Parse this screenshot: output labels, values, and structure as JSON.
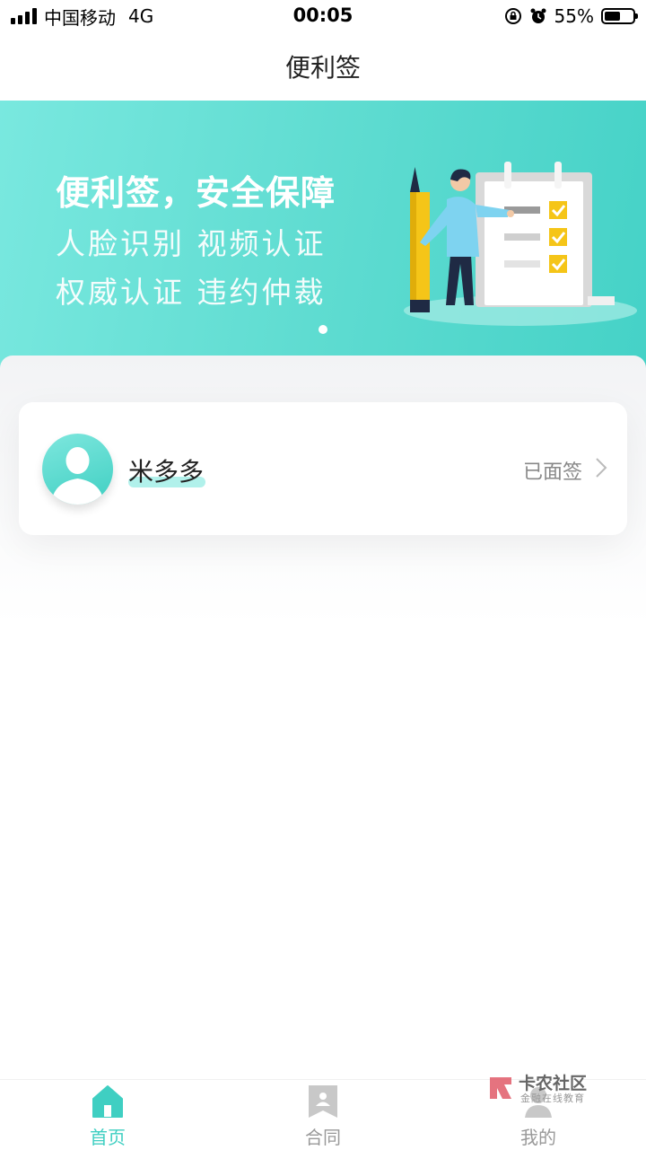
{
  "status_bar": {
    "carrier": "中国移动",
    "network": "4G",
    "time": "00:05",
    "battery_percent": "55%",
    "battery_level": 0.55
  },
  "nav": {
    "title": "便利签"
  },
  "banner": {
    "headline": "便利签，安全保障",
    "line1": "人脸识别 视频认证",
    "line2": "权威认证 违约仲裁",
    "slide_count": 1,
    "active_slide": 1,
    "colors": {
      "gradient_start": "#79e8df",
      "gradient_end": "#45d2c7"
    }
  },
  "card": {
    "name": "米多多",
    "status": "已面签",
    "avatar_icon": "default-person-avatar",
    "chevron_icon": "chevron-right-icon"
  },
  "tabs": [
    {
      "label": "首页",
      "icon": "home-icon",
      "active": true
    },
    {
      "label": "合同",
      "icon": "contract-icon",
      "active": false
    },
    {
      "label": "我的",
      "icon": "profile-icon",
      "active": false
    }
  ],
  "watermark": {
    "brand": "卡农社区",
    "tagline": "金融在线教育"
  },
  "colors": {
    "accent": "#3fcfc2",
    "inactive": "#999999"
  }
}
